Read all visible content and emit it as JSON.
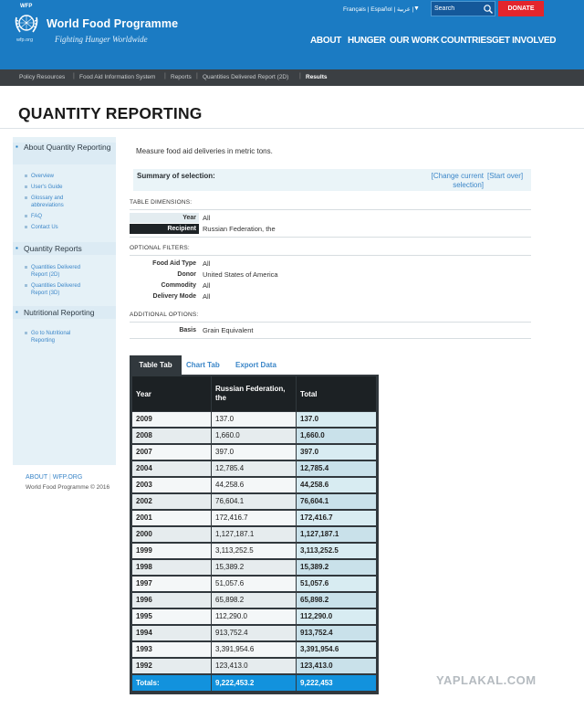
{
  "header": {
    "logo_small": "WFP",
    "logo_url_text": "wfp.org",
    "brand_title": "World Food Programme",
    "brand_tagline": "Fighting Hunger Worldwide",
    "languages": "Français | Español | عربية |",
    "search_placeholder": "Search",
    "donate_label": "DONATE",
    "nav": [
      "ABOUT",
      "HUNGER",
      "OUR WORK",
      "COUNTRIES",
      "GET INVOLVED"
    ]
  },
  "breadcrumb": [
    "Policy Resources",
    "Food Aid Information System",
    "Reports",
    "Quantities Delivered Report (2D)",
    "Results"
  ],
  "page_title": "QUANTITY REPORTING",
  "sidebar": {
    "sections": [
      {
        "title": "About Quantity Reporting",
        "links": [
          "Overview",
          "User's Guide",
          "Glossary and abbreviations",
          "FAQ",
          "Contact Us"
        ]
      },
      {
        "title": "Quantity Reports",
        "links": [
          "Quantities Delivered Report (2D)",
          "Quantities Delivered Report (3D)"
        ]
      },
      {
        "title": "Nutritional Reporting",
        "links": [
          "Go to Nutritional Reporting"
        ]
      }
    ]
  },
  "footer": {
    "about": "ABOUT",
    "site": "WFP.ORG",
    "copyright": "World Food Programme © 2016"
  },
  "main": {
    "measure_text": "Measure food aid deliveries in metric tons.",
    "summary_label": "Summary of selection:",
    "change_link": "[Change current selection]",
    "start_over_link": "[Start over]",
    "table_dimensions_label": "TABLE DIMENSIONS:",
    "table_dimensions": [
      {
        "key": "Year",
        "value": "All"
      },
      {
        "key": "Recipient",
        "value": "Russian Federation, the"
      }
    ],
    "optional_filters_label": "OPTIONAL FILTERS:",
    "optional_filters": [
      {
        "key": "Food Aid Type",
        "value": "All"
      },
      {
        "key": "Donor",
        "value": "United States of America"
      },
      {
        "key": "Commodity",
        "value": "All"
      },
      {
        "key": "Delivery Mode",
        "value": "All"
      }
    ],
    "additional_options_label": "ADDITIONAL OPTIONS:",
    "additional_options": [
      {
        "key": "Basis",
        "value": "Grain Equivalent"
      }
    ]
  },
  "tabs": {
    "active": "Table Tab",
    "chart": "Chart Tab",
    "export": "Export Data"
  },
  "table": {
    "headers": [
      "Year",
      "Russian Federation, the",
      "Total"
    ],
    "rows": [
      [
        "2009",
        "137.0",
        "137.0"
      ],
      [
        "2008",
        "1,660.0",
        "1,660.0"
      ],
      [
        "2007",
        "397.0",
        "397.0"
      ],
      [
        "2004",
        "12,785.4",
        "12,785.4"
      ],
      [
        "2003",
        "44,258.6",
        "44,258.6"
      ],
      [
        "2002",
        "76,604.1",
        "76,604.1"
      ],
      [
        "2001",
        "172,416.7",
        "172,416.7"
      ],
      [
        "2000",
        "1,127,187.1",
        "1,127,187.1"
      ],
      [
        "1999",
        "3,113,252.5",
        "3,113,252.5"
      ],
      [
        "1998",
        "15,389.2",
        "15,389.2"
      ],
      [
        "1997",
        "51,057.6",
        "51,057.6"
      ],
      [
        "1996",
        "65,898.2",
        "65,898.2"
      ],
      [
        "1995",
        "112,290.0",
        "112,290.0"
      ],
      [
        "1994",
        "913,752.4",
        "913,752.4"
      ],
      [
        "1993",
        "3,391,954.6",
        "3,391,954.6"
      ],
      [
        "1992",
        "123,413.0",
        "123,413.0"
      ]
    ],
    "totals": [
      "Totals:",
      "9,222,453.2",
      "9,222,453"
    ]
  },
  "watermark": "YAPLAKAL.COM",
  "colors": {
    "brand_blue": "#1b7bc3",
    "donate_red": "#e3252c",
    "dark_bar": "#3b3f43",
    "total_row": "#1292dd"
  }
}
